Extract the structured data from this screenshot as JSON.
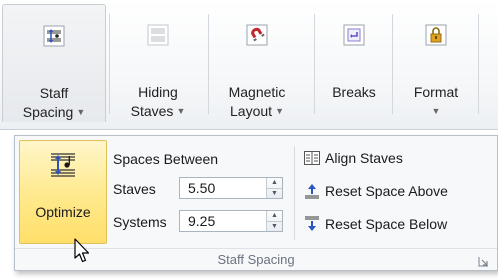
{
  "ribbon": {
    "buttons": [
      {
        "id": "staff-spacing",
        "label": "Staff\nSpacing",
        "icon": "staff-spacing-icon"
      },
      {
        "id": "hiding-staves",
        "label": "Hiding\nStaves",
        "icon": "hiding-staves-icon"
      },
      {
        "id": "magnetic-layout",
        "label": "Magnetic\nLayout",
        "icon": "magnet-icon"
      },
      {
        "id": "breaks",
        "label": "Breaks",
        "icon": "breaks-icon"
      },
      {
        "id": "format",
        "label": "Format",
        "icon": "lock-icon"
      }
    ]
  },
  "panel": {
    "optimize_label": "Optimize",
    "spaces_between_label": "Spaces Between",
    "staves_label": "Staves",
    "staves_value": "5.50",
    "systems_label": "Systems",
    "systems_value": "9.25",
    "align_staves_label": "Align Staves",
    "reset_above_label": "Reset Space Above",
    "reset_below_label": "Reset Space Below",
    "group_title": "Staff Spacing"
  },
  "colors": {
    "optimize_highlight": "#ffe98c",
    "arrow_blue": "#2b55c4",
    "magnet_red": "#c0282b"
  }
}
